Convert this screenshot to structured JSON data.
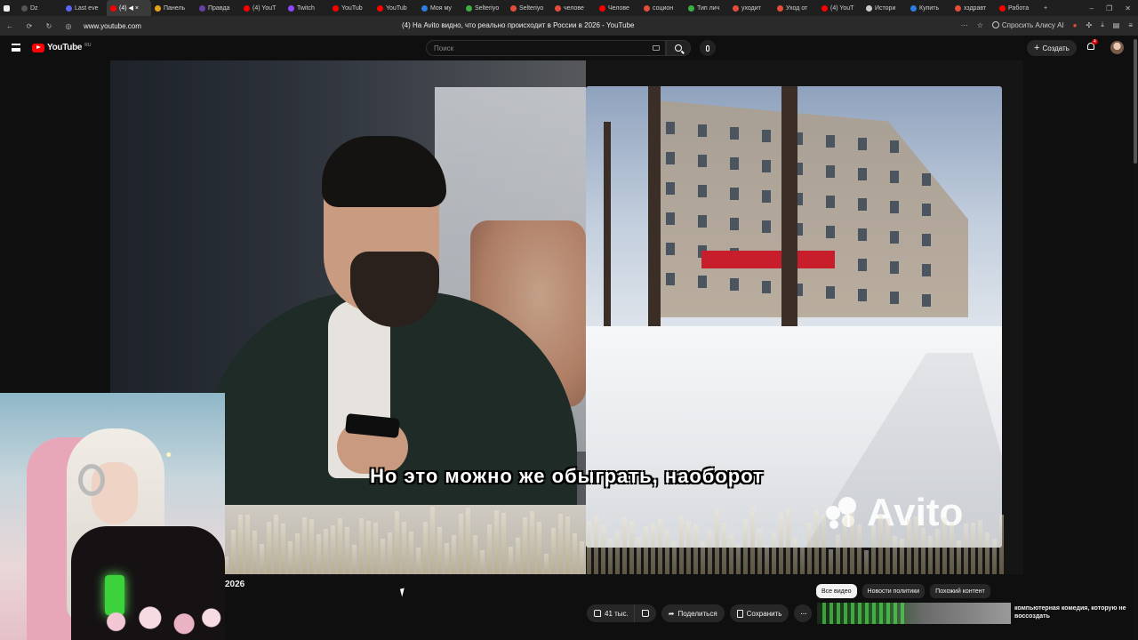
{
  "browser": {
    "tabs": [
      {
        "label": "Dz",
        "color": "#555555",
        "active": false
      },
      {
        "label": "Last eve",
        "color": "#5865f2",
        "active": false
      },
      {
        "label": "(4) ◀ ×",
        "color": "#ff0000",
        "active": true
      },
      {
        "label": "Панель",
        "color": "#e3a21a",
        "active": false
      },
      {
        "label": "Правда",
        "color": "#6441a5",
        "active": false
      },
      {
        "label": "(4) YouT",
        "color": "#ff0000",
        "active": false
      },
      {
        "label": "Twitch",
        "color": "#9146ff",
        "active": false
      },
      {
        "label": "YouTub",
        "color": "#ff0000",
        "active": false
      },
      {
        "label": "YouTub",
        "color": "#ff0000",
        "active": false
      },
      {
        "label": "Моя му",
        "color": "#2a7de1",
        "active": false
      },
      {
        "label": "Selteriyo",
        "color": "#3cb043",
        "active": false
      },
      {
        "label": "Selteriyo",
        "color": "#e44d3a",
        "active": false
      },
      {
        "label": "челове",
        "color": "#e44d3a",
        "active": false
      },
      {
        "label": "Челове",
        "color": "#ff0000",
        "active": false
      },
      {
        "label": "социон",
        "color": "#e44d3a",
        "active": false
      },
      {
        "label": "Тип лич",
        "color": "#3cb043",
        "active": false
      },
      {
        "label": "уходит",
        "color": "#e44d3a",
        "active": false
      },
      {
        "label": "Уход от",
        "color": "#e44d3a",
        "active": false
      },
      {
        "label": "(4) YouT",
        "color": "#ff0000",
        "active": false
      },
      {
        "label": "Истори",
        "color": "#cccccc",
        "active": false
      },
      {
        "label": "Купить",
        "color": "#2a7de1",
        "active": false
      },
      {
        "label": "хздравт",
        "color": "#e44d3a",
        "active": false
      },
      {
        "label": "Работа",
        "color": "#ff0000",
        "active": false
      }
    ],
    "new_tab": "+",
    "url": "www.youtube.com",
    "page_title": "(4) На Avito видно, что реально происходит в России в 2026 - YouTube",
    "alice": "Спросить Алису AI"
  },
  "youtube": {
    "logo": "YouTube",
    "region": "RU",
    "search_placeholder": "Поиск",
    "create_label": "Создать",
    "notif_count": "4"
  },
  "video": {
    "subtitle": "Но это можно же обыграть, наоборот",
    "watermark": "Avito",
    "title_fragment": "2026"
  },
  "actions": {
    "likes": "41 тыс.",
    "share": "Поделиться",
    "save": "Сохранить",
    "more": "···"
  },
  "chips": [
    {
      "label": "Все видео",
      "active": true
    },
    {
      "label": "Новости политики",
      "active": false
    },
    {
      "label": "Похожий контент",
      "active": false
    }
  ],
  "recommendation": {
    "title": "компьютерная комедия, которую не воссоздать"
  }
}
